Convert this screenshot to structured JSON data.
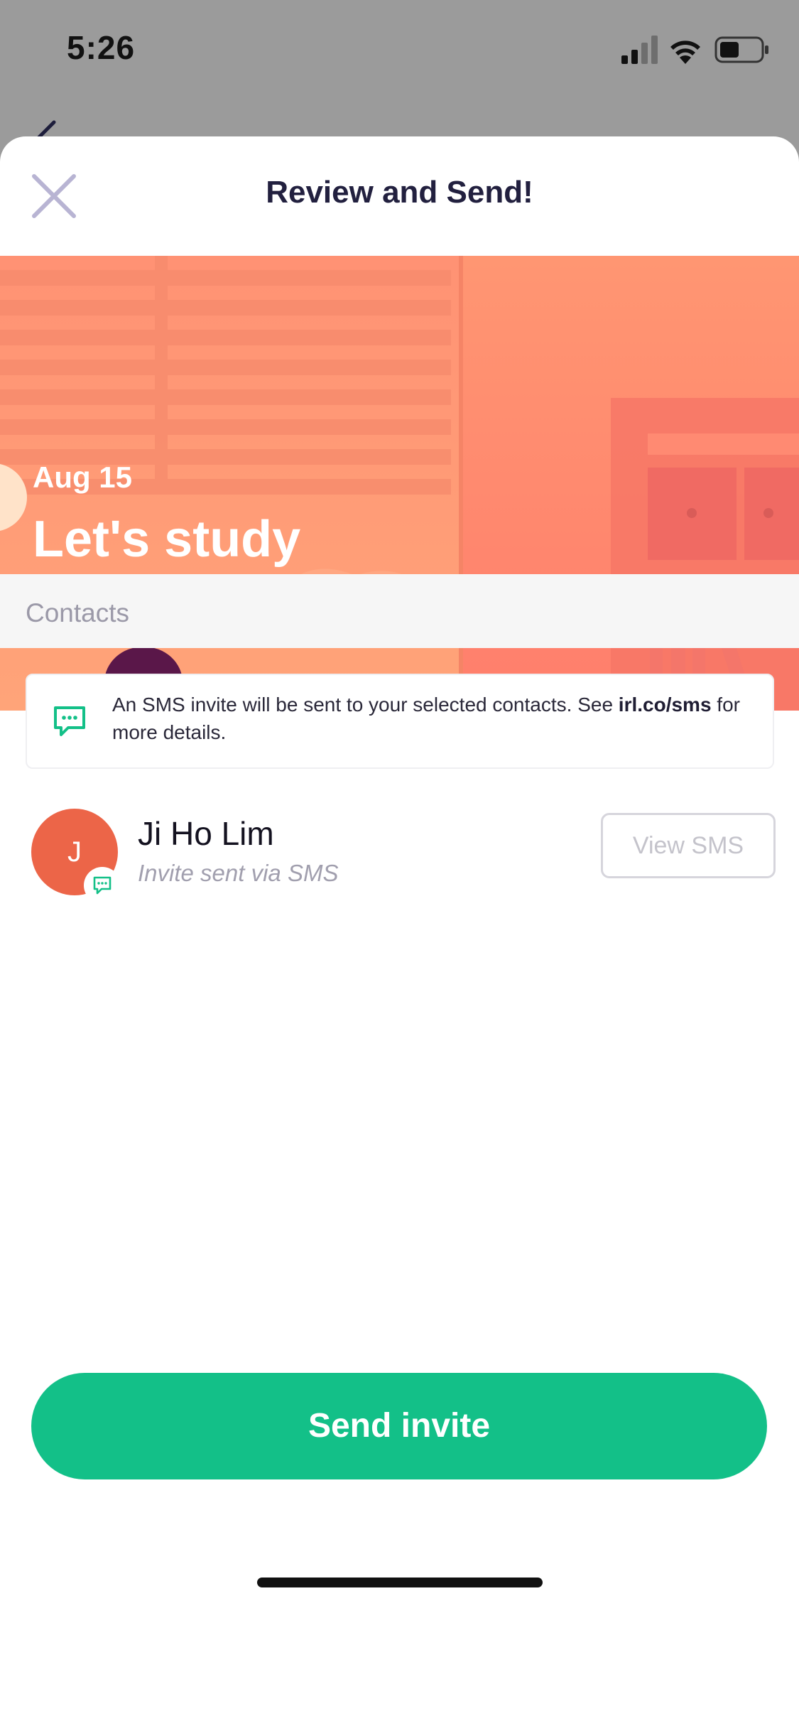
{
  "status_bar": {
    "time": "5:26"
  },
  "sheet": {
    "title": "Review and Send!",
    "close_icon": "close-icon"
  },
  "event": {
    "date": "Aug 15",
    "name": "Let's study"
  },
  "contacts": {
    "section_label": "Contacts",
    "info": {
      "icon": "chat-bubble-icon",
      "text_before": "An SMS invite will be sent to your selected contacts. See ",
      "link": "irl.co/sms",
      "text_after": " for more details."
    },
    "items": [
      {
        "initial": "J",
        "name": "Ji Ho Lim",
        "status": "Invite sent via SMS",
        "action_label": "View SMS",
        "avatar_color": "#ec6548"
      }
    ]
  },
  "primary_action": {
    "label": "Send invite",
    "color": "#13c088"
  }
}
